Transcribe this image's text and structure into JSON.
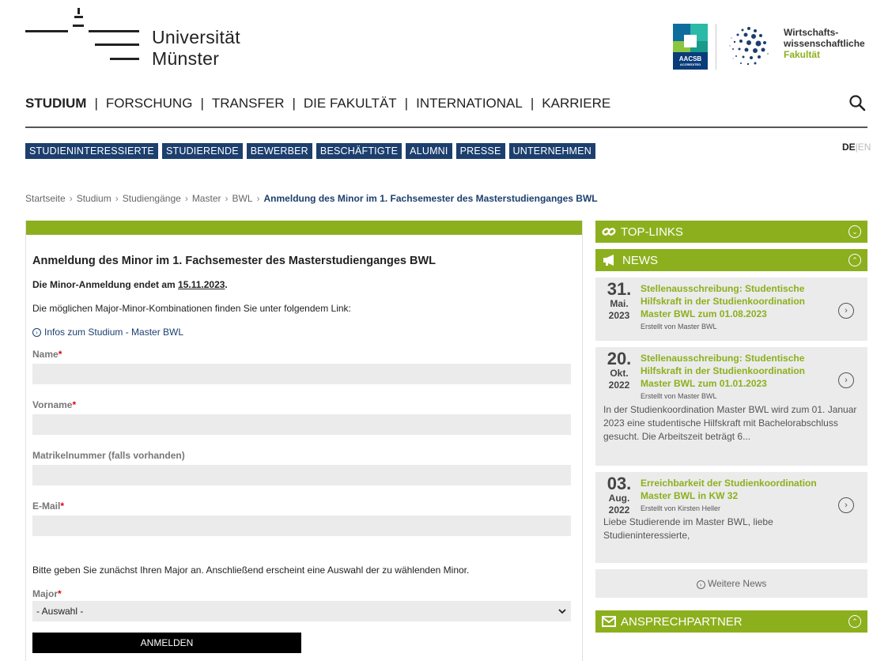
{
  "header": {
    "uni_line1": "Universität",
    "uni_line2": "Münster",
    "aacsb_label": "AACSB",
    "aacsb_sub": "ACCREDITED",
    "fak_line1": "Wirtschafts-",
    "fak_line2": "wissenschaftliche",
    "fak_line3": "Fakultät"
  },
  "mainnav": [
    "STUDIUM",
    "FORSCHUNG",
    "TRANSFER",
    "DIE FAKULTÄT",
    "INTERNATIONAL",
    "KARRIERE"
  ],
  "subnav": [
    "STUDIENINTERESSIERTE",
    "STUDIERENDE",
    "BEWERBER",
    "BESCHÄFTIGTE",
    "ALUMNI",
    "PRESSE",
    "UNTERNEHMEN"
  ],
  "lang": {
    "de": "DE",
    "sep": "|",
    "en": "EN"
  },
  "breadcrumb": {
    "items": [
      "Startseite",
      "Studium",
      "Studiengänge",
      "Master",
      "BWL"
    ],
    "current": "Anmeldung des Minor im 1. Fachsemester des Masterstudienganges BWL",
    "sep": "›"
  },
  "form": {
    "title": "Anmeldung des Minor im 1. Fachsemester des Masterstudienganges BWL",
    "deadline_text": "Die Minor-Anmeldung endet am ",
    "deadline_date": "15.11.2023",
    "deadline_end": ".",
    "combo_text": "Die möglichen Major-Minor-Kombinationen finden Sie unter folgendem Link:",
    "info_link": "Infos zum Studium - Master BWL",
    "name_label": "Name",
    "vorname_label": "Vorname",
    "matrikel_label": "Matrikelnummer (falls vorhanden)",
    "email_label": "E-Mail",
    "required_mark": "*",
    "major_hint": "Bitte geben Sie zunächst Ihren Major an. Anschließend erscheint eine Auswahl der zu wählenden Minor.",
    "major_label": "Major",
    "major_value": "- Auswahl -",
    "submit_label": "ANMELDEN"
  },
  "sidebar": {
    "toplinks_label": "TOP-LINKS",
    "news_label": "NEWS",
    "news": [
      {
        "day": "31.",
        "month": "Mai.",
        "year": "2023",
        "title": "Stellenausschreibung: Studentische Hilfskraft in der Studienkoordination Master BWL zum 01.08.2023",
        "by": "Erstellt von Master BWL",
        "text": ""
      },
      {
        "day": "20.",
        "month": "Okt.",
        "year": "2022",
        "title": "Stellenausschreibung: Studentische Hilfskraft in der Studienkoordination Master BWL zum 01.01.2023",
        "by": "Erstellt von Master BWL",
        "text": "In der Studienkoordination Master BWL wird zum 01. Januar 2023 eine studentische Hilfskraft mit Bachelorabschluss gesucht. Die Arbeitszeit beträgt 6..."
      },
      {
        "day": "03.",
        "month": "Aug.",
        "year": "2022",
        "title": "Erreichbarkeit der Studienkoordination Master BWL in KW 32",
        "by": "Erstellt von Kirsten Heller",
        "text": "Liebe Studierende im Master BWL, liebe Studieninteressierte,"
      }
    ],
    "more_news": "Weitere News",
    "contact_label": "ANSPRECHPARTNER"
  },
  "colors": {
    "green": "#8cb01d",
    "navy": "#1c3f6e",
    "required": "#e3000f"
  }
}
